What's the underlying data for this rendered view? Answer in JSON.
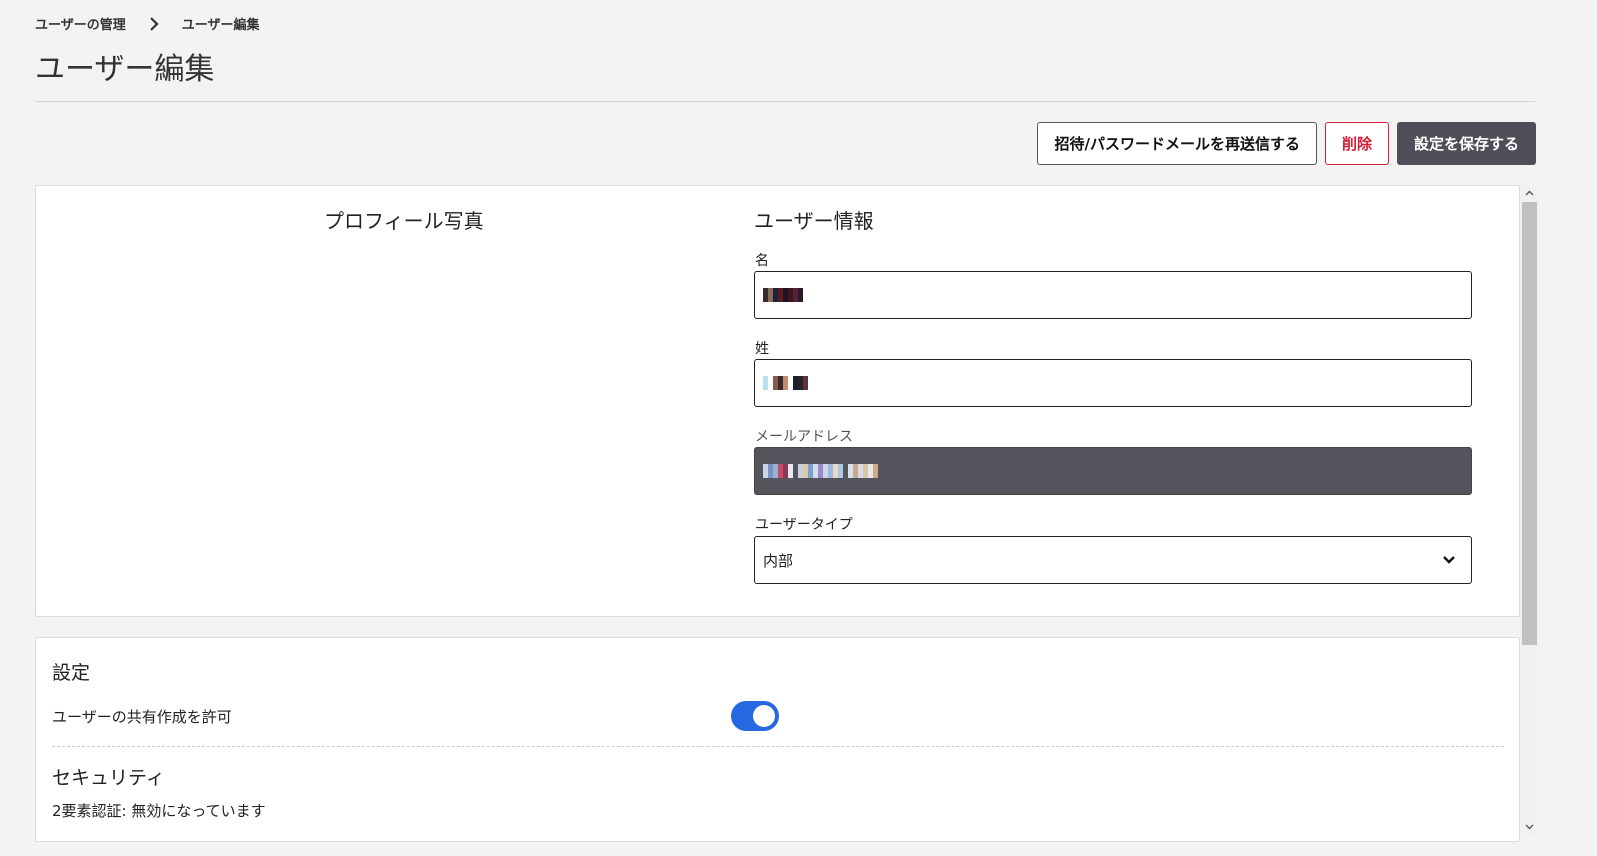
{
  "breadcrumb": {
    "parent": "ユーザーの管理",
    "current": "ユーザー編集"
  },
  "page_title": "ユーザー編集",
  "actions": {
    "resend_label": "招待/パスワードメールを再送信する",
    "delete_label": "削除",
    "save_label": "設定を保存する"
  },
  "profile": {
    "title": "プロフィール写真"
  },
  "user_info": {
    "title": "ユーザー情報",
    "first_name_label": "名",
    "last_name_label": "姓",
    "email_label": "メールアドレス",
    "user_type_label": "ユーザータイプ",
    "user_type_value": "内部",
    "first_name_value_redacted": true,
    "last_name_value_redacted": true,
    "email_value_redacted": true
  },
  "settings": {
    "title": "設定",
    "allow_share_label": "ユーザーの共有作成を許可",
    "allow_share_enabled": true
  },
  "security": {
    "title": "セキュリティ",
    "twofa_status": "2要素認証: 無効になっています"
  },
  "colors": {
    "background": "#f3f3f3",
    "primary_button": "#4d4e57",
    "danger": "#d3213a",
    "toggle_on": "#2767e0",
    "disabled_field": "#53545c"
  }
}
